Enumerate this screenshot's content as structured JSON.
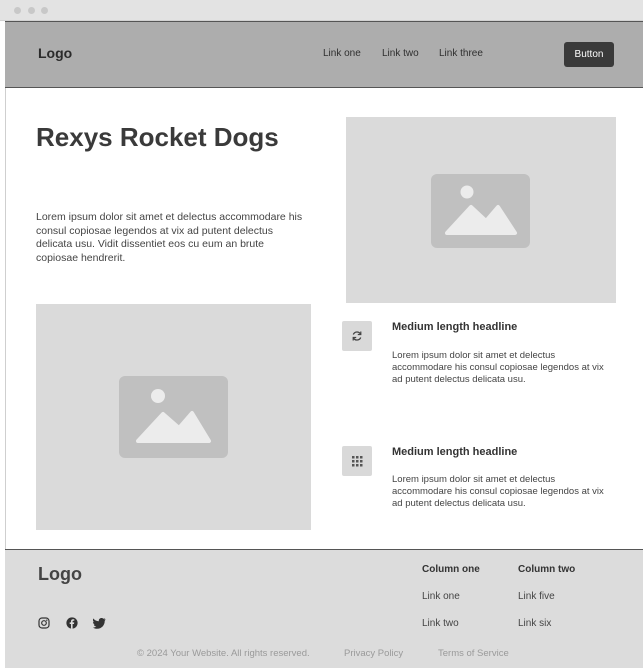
{
  "nav": {
    "logo": "Logo",
    "links": [
      "Link one",
      "Link two",
      "Link three"
    ],
    "button_label": "Button"
  },
  "hero": {
    "title": "Rexys Rocket Dogs",
    "text": "Lorem ipsum dolor sit amet et delectus accommodare his consul copiosae legendos at vix ad putent delectus delicata usu. Vidit dissentiet eos cu eum an brute copiosae hendrerit."
  },
  "features": [
    {
      "icon": "refresh-icon",
      "title": "Medium length headline",
      "text": "Lorem ipsum dolor sit amet et delectus accommodare his consul copiosae legendos at vix ad putent delectus delicata usu."
    },
    {
      "icon": "grid-icon",
      "title": "Medium length headline",
      "text": "Lorem ipsum dolor sit amet et delectus accommodare his consul copiosae legendos at vix ad putent delectus delicata usu."
    }
  ],
  "footer": {
    "logo": "Logo",
    "socials": [
      "instagram-icon",
      "facebook-icon",
      "twitter-icon"
    ],
    "columns": [
      {
        "heading": "Column one",
        "links": [
          "Link one",
          "Link two"
        ]
      },
      {
        "heading": "Column two",
        "links": [
          "Link five",
          "Link six"
        ]
      }
    ],
    "copyright": "© 2024 Your Website. All rights reserved.",
    "privacy": "Privacy Policy",
    "terms": "Terms of Service"
  },
  "colors": {
    "navbar_bg": "#adadad",
    "button_bg": "#3a3a3a",
    "placeholder_bg": "#dadada",
    "footer_bg": "#dcdcdc"
  }
}
